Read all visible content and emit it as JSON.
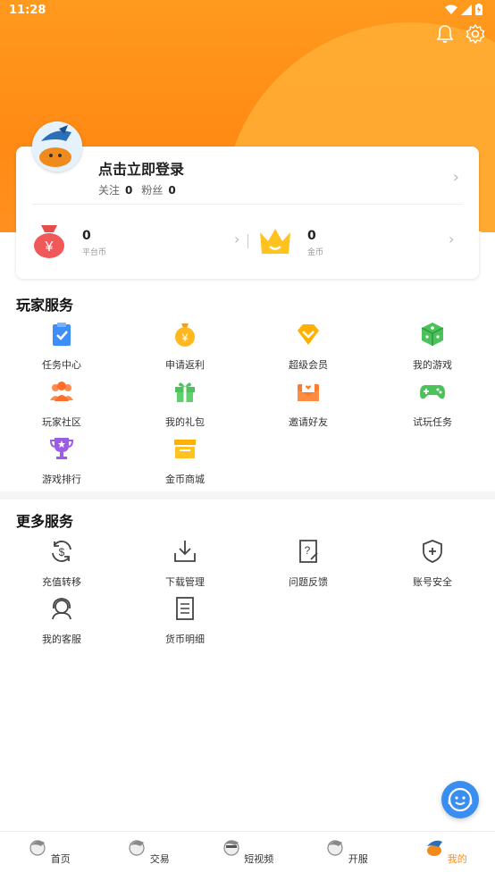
{
  "status": {
    "time": "11:28"
  },
  "header": {
    "bell_icon": "bell-icon",
    "settings_icon": "gear-icon"
  },
  "profile": {
    "login_text": "点击立即登录",
    "follow_label": "关注",
    "follow_count": "0",
    "fans_label": "粉丝",
    "fans_count": "0"
  },
  "wallet": {
    "platform": {
      "value": "0",
      "label": "平台币"
    },
    "gold": {
      "value": "0",
      "label": "金币"
    }
  },
  "player_services": {
    "title": "玩家服务",
    "items": [
      {
        "label": "任务中心",
        "icon": "task-clipboard-icon"
      },
      {
        "label": "申请返利",
        "icon": "money-bag-icon"
      },
      {
        "label": "超级会员",
        "icon": "diamond-icon"
      },
      {
        "label": "我的游戏",
        "icon": "dice-icon"
      },
      {
        "label": "玩家社区",
        "icon": "community-icon"
      },
      {
        "label": "我的礼包",
        "icon": "gift-icon"
      },
      {
        "label": "邀请好友",
        "icon": "invite-envelope-icon"
      },
      {
        "label": "试玩任务",
        "icon": "gamepad-icon"
      },
      {
        "label": "游戏排行",
        "icon": "trophy-icon"
      },
      {
        "label": "金币商城",
        "icon": "store-icon"
      }
    ]
  },
  "more_services": {
    "title": "更多服务",
    "items": [
      {
        "label": "充值转移",
        "icon": "recharge-transfer-icon"
      },
      {
        "label": "下载管理",
        "icon": "download-icon"
      },
      {
        "label": "问题反馈",
        "icon": "feedback-icon"
      },
      {
        "label": "账号安全",
        "icon": "shield-icon"
      },
      {
        "label": "我的客服",
        "icon": "headset-icon"
      },
      {
        "label": "货币明细",
        "icon": "list-icon"
      }
    ]
  },
  "tabs": [
    {
      "label": "首页",
      "icon": "home-icon"
    },
    {
      "label": "交易",
      "icon": "trade-icon"
    },
    {
      "label": "短视频",
      "icon": "video-icon"
    },
    {
      "label": "开服",
      "icon": "server-icon"
    },
    {
      "label": "我的",
      "icon": "me-icon",
      "active": true
    }
  ],
  "colors": {
    "accent": "#ff8a14",
    "blue": "#3a8ef0"
  }
}
